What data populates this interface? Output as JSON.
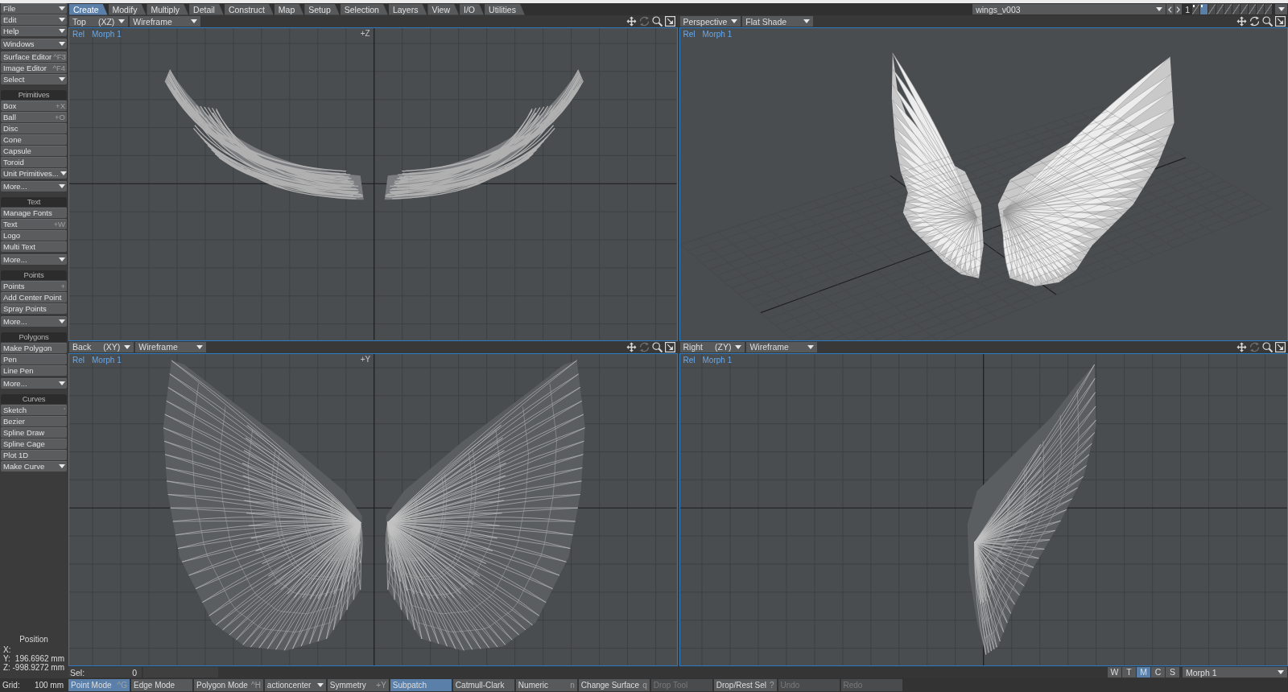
{
  "menu_tabs": [
    {
      "label": "Create",
      "selected": true
    },
    {
      "label": "Modify",
      "selected": false
    },
    {
      "label": "Multiply",
      "selected": false
    },
    {
      "label": "Detail",
      "selected": false
    },
    {
      "label": "Construct",
      "selected": false
    },
    {
      "label": "Map",
      "selected": false
    },
    {
      "label": "Setup",
      "selected": false
    },
    {
      "label": "Selection",
      "selected": false
    },
    {
      "label": "Layers",
      "selected": false
    },
    {
      "label": "View",
      "selected": false
    },
    {
      "label": "I/O",
      "selected": false
    },
    {
      "label": "Utilities",
      "selected": false
    }
  ],
  "object_selector": {
    "value": "wings_v003"
  },
  "layer_bank": {
    "number": "1",
    "layers": [
      {
        "selected": false,
        "has_data": true
      },
      {
        "selected": true,
        "has_data": true
      },
      {
        "selected": false,
        "has_data": false
      },
      {
        "selected": false,
        "has_data": false
      },
      {
        "selected": false,
        "has_data": false
      },
      {
        "selected": false,
        "has_data": false
      },
      {
        "selected": false,
        "has_data": false
      },
      {
        "selected": false,
        "has_data": false
      },
      {
        "selected": false,
        "has_data": false
      },
      {
        "selected": false,
        "has_data": false
      }
    ]
  },
  "sidebar": {
    "sections": [
      {
        "groups": [
          {
            "items": [
              {
                "kind": "dropdown",
                "label": "File"
              },
              {
                "kind": "dropdown",
                "label": "Edit"
              },
              {
                "kind": "dropdown",
                "label": "Help"
              }
            ]
          },
          {
            "items": [
              {
                "kind": "dropdown",
                "label": "Windows"
              }
            ]
          },
          {
            "items": [
              {
                "kind": "button",
                "label": "Surface Editor",
                "shortcut": "^F3"
              },
              {
                "kind": "button",
                "label": "Image Editor",
                "shortcut": "^F4"
              },
              {
                "kind": "dropdown",
                "label": "Select"
              }
            ]
          }
        ]
      },
      {
        "header": "Primitives",
        "groups": [
          {
            "items": [
              {
                "kind": "button",
                "label": "Box",
                "shortcut": "+X"
              },
              {
                "kind": "button",
                "label": "Ball",
                "shortcut": "+O"
              },
              {
                "kind": "button",
                "label": "Disc"
              },
              {
                "kind": "button",
                "label": "Cone"
              },
              {
                "kind": "button",
                "label": "Capsule"
              },
              {
                "kind": "button",
                "label": "Toroid"
              },
              {
                "kind": "dropdown",
                "label": "Unit Primitives..."
              }
            ]
          },
          {
            "items": [
              {
                "kind": "dropdown",
                "label": "More..."
              }
            ]
          }
        ]
      },
      {
        "header": "Text",
        "groups": [
          {
            "items": [
              {
                "kind": "button",
                "label": "Manage Fonts"
              },
              {
                "kind": "button",
                "label": "Text",
                "shortcut": "+W"
              },
              {
                "kind": "button",
                "label": "Logo"
              },
              {
                "kind": "button",
                "label": "Multi Text"
              }
            ]
          },
          {
            "items": [
              {
                "kind": "dropdown",
                "label": "More..."
              }
            ]
          }
        ]
      },
      {
        "header": "Points",
        "groups": [
          {
            "items": [
              {
                "kind": "button",
                "label": "Points",
                "shortcut": "+"
              },
              {
                "kind": "button",
                "label": "Add Center Point"
              },
              {
                "kind": "button",
                "label": "Spray Points"
              }
            ]
          },
          {
            "items": [
              {
                "kind": "dropdown",
                "label": "More..."
              }
            ]
          }
        ]
      },
      {
        "header": "Polygons",
        "groups": [
          {
            "items": [
              {
                "kind": "button",
                "label": "Make Polygon"
              },
              {
                "kind": "button",
                "label": "Pen"
              },
              {
                "kind": "button",
                "label": "Line Pen"
              }
            ]
          },
          {
            "items": [
              {
                "kind": "dropdown",
                "label": "More..."
              }
            ]
          }
        ]
      },
      {
        "header": "Curves",
        "groups": [
          {
            "items": [
              {
                "kind": "button",
                "label": "Sketch",
                "shortcut": "'"
              },
              {
                "kind": "button",
                "label": "Bezier"
              },
              {
                "kind": "button",
                "label": "Spline Draw"
              },
              {
                "kind": "button",
                "label": "Spline Cage"
              },
              {
                "kind": "button",
                "label": "Plot 1D"
              },
              {
                "kind": "dropdown",
                "label": "Make Curve"
              }
            ]
          }
        ]
      }
    ],
    "position": {
      "title": "Position",
      "rows": [
        {
          "axis": "X:"
        },
        {
          "axis": "Y:",
          "value": "196.6962 mm"
        },
        {
          "axis": "Z:",
          "value": "-998.9272 mm"
        }
      ]
    }
  },
  "viewports": [
    {
      "kind": "top",
      "view": "Top",
      "axes": "(XZ)",
      "mode": "Wireframe",
      "rotate_enabled": false,
      "overlay": {
        "space": "Rel",
        "morph": "Morph 1"
      },
      "axis_label": "+Z"
    },
    {
      "kind": "perspective",
      "view": "Perspective",
      "mode": "Flat Shade",
      "rotate_enabled": true,
      "overlay": {
        "space": "Rel",
        "morph": "Morph 1"
      }
    },
    {
      "kind": "back",
      "view": "Back",
      "axes": "(XY)",
      "mode": "Wireframe",
      "rotate_enabled": false,
      "overlay": {
        "space": "Rel",
        "morph": "Morph 1"
      },
      "axis_label": "+Y"
    },
    {
      "kind": "right",
      "view": "Right",
      "axes": "(ZY)",
      "mode": "Wireframe",
      "rotate_enabled": false,
      "overlay": {
        "space": "Rel",
        "morph": "Morph 1"
      }
    }
  ],
  "sel_bar": {
    "label": "Sel:",
    "value": "0",
    "weight_modes": [
      {
        "label": "W",
        "selected": false
      },
      {
        "label": "T",
        "selected": false
      },
      {
        "label": "M",
        "selected": true
      },
      {
        "label": "C",
        "selected": false
      },
      {
        "label": "S",
        "selected": false
      }
    ],
    "morph": "Morph 1"
  },
  "bottom_bar": {
    "grid_label": "Grid:",
    "grid_value": "100 mm",
    "buttons": [
      {
        "kind": "toggle",
        "label": "Point Mode",
        "shortcut": "^G",
        "selected": true,
        "disabled": false
      },
      {
        "kind": "toggle",
        "label": "Edge Mode",
        "selected": false,
        "disabled": false
      },
      {
        "kind": "toggle",
        "label": "Polygon Mode",
        "shortcut": "^H",
        "selected": false,
        "disabled": false
      },
      {
        "kind": "dropdown",
        "label": "actioncenter",
        "selected": false,
        "disabled": false
      },
      {
        "kind": "toggle",
        "label": "Symmetry",
        "shortcut": "+Y",
        "selected": false,
        "disabled": false
      },
      {
        "kind": "toggle",
        "label": "Subpatch",
        "selected": true,
        "disabled": false
      },
      {
        "kind": "toggle",
        "label": "Catmull-Clark",
        "selected": false,
        "disabled": false
      },
      {
        "kind": "toggle",
        "label": "Numeric",
        "shortcut": "n",
        "selected": false,
        "disabled": false
      },
      {
        "kind": "toggle",
        "label": "Change Surface",
        "shortcut": "q",
        "selected": false,
        "disabled": false
      },
      {
        "kind": "toggle",
        "label": "Drop Tool",
        "selected": false,
        "disabled": true
      },
      {
        "kind": "toggle",
        "label": "Drop/Rest Sel",
        "shortcut": "?",
        "selected": false,
        "disabled": false
      },
      {
        "kind": "toggle",
        "label": "Undo",
        "selected": false,
        "disabled": true
      },
      {
        "kind": "toggle",
        "label": "Redo",
        "selected": false,
        "disabled": true
      }
    ]
  }
}
